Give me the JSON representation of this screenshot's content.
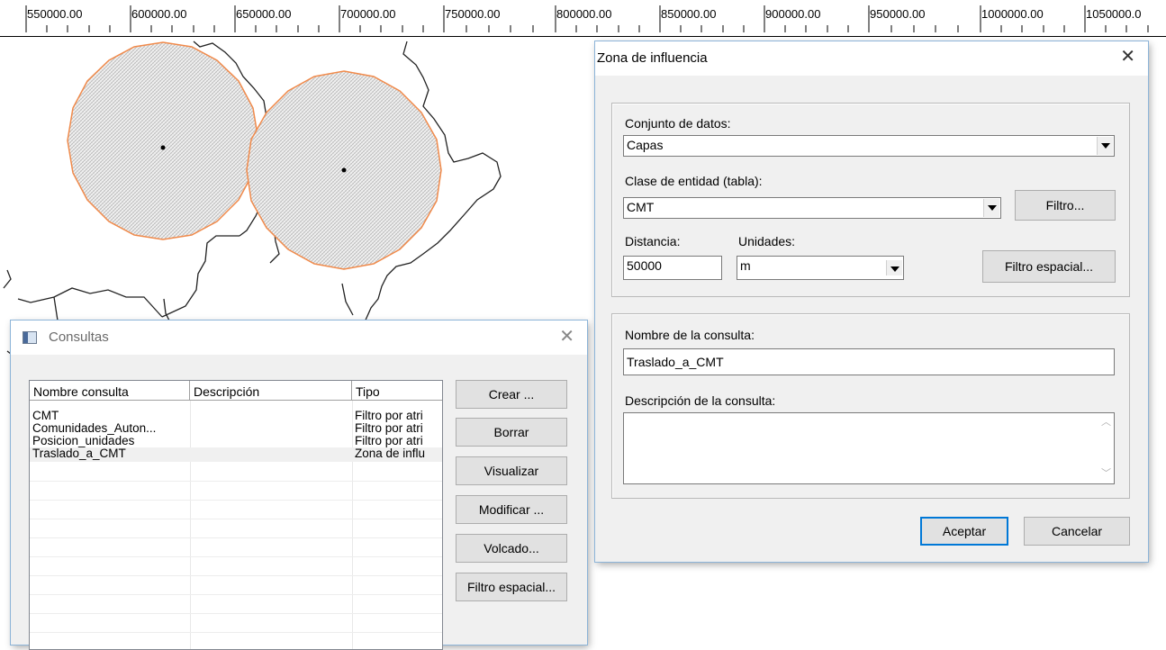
{
  "ruler": {
    "labels": [
      "550000.00",
      "600000.00",
      "650000.00",
      "700000.00",
      "750000.00",
      "800000.00",
      "850000.00",
      "900000.00",
      "950000.00",
      "1000000.00",
      "1050000.0"
    ]
  },
  "colors": {
    "buffer_stroke": "#f08a4b",
    "accent": "#0078d7",
    "window_bg": "#f0f0f0"
  },
  "zona_dialog": {
    "title": "Zona de influencia",
    "conjunto_label": "Conjunto de datos:",
    "conjunto_value": "Capas",
    "clase_label": "Clase de entidad (tabla):",
    "clase_value": "CMT",
    "filtro_button": "Filtro...",
    "distancia_label": "Distancia:",
    "distancia_value": "50000",
    "unidades_label": "Unidades:",
    "unidades_value": "m",
    "filtro_espacial_button": "Filtro espacial...",
    "nombre_label": "Nombre de la consulta:",
    "nombre_value": "Traslado_a_CMT",
    "descripcion_label": "Descripción de la consulta:",
    "descripcion_value": "",
    "aceptar_button": "Aceptar",
    "cancelar_button": "Cancelar"
  },
  "consultas_window": {
    "title": "Consultas",
    "columns": [
      "Nombre consulta",
      "Descripción",
      "Tipo"
    ],
    "rows": [
      {
        "nombre": "CMT",
        "descripcion": "",
        "tipo": "Filtro por atri"
      },
      {
        "nombre": "Comunidades_Auton...",
        "descripcion": "",
        "tipo": "Filtro por atri"
      },
      {
        "nombre": "Posicion_unidades",
        "descripcion": "",
        "tipo": "Filtro por atri"
      },
      {
        "nombre": "Traslado_a_CMT",
        "descripcion": "",
        "tipo": "Zona de influ"
      }
    ],
    "buttons": {
      "crear": "Crear ...",
      "borrar": "Borrar",
      "visualizar": "Visualizar",
      "modificar": "Modificar ...",
      "volcado": "Volcado...",
      "filtro_espacial": "Filtro espacial..."
    }
  },
  "icons": {
    "window_icon": "window-icon",
    "close": "close-icon",
    "dropdown": "chevron-down-icon"
  }
}
